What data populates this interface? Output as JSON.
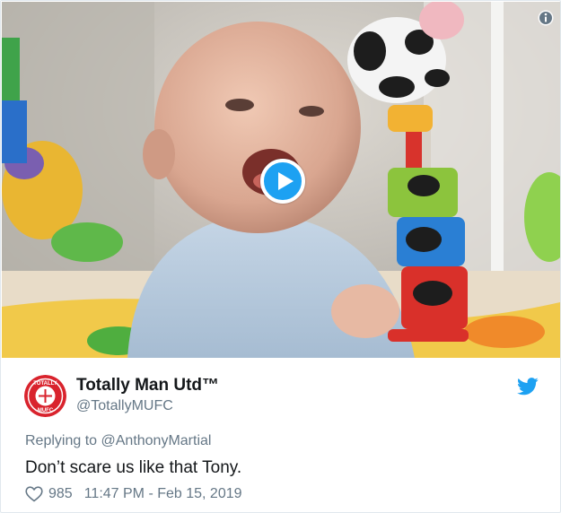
{
  "media": {
    "image": "baby-laughing-gif-thumbnail",
    "play_icon": "play-icon",
    "info_icon": "info-icon"
  },
  "author": {
    "display_name": "Totally Man Utd™",
    "handle": "@TotallyMUFC",
    "avatar": "totally-mufc-badge-avatar",
    "avatar_text_top": "TOTALLY",
    "avatar_text_bottom": "MUFC"
  },
  "reply": {
    "prefix": "Replying to ",
    "mention": "@AnthonyMartial"
  },
  "tweet": {
    "text": "Don’t scare us like that Tony."
  },
  "footer": {
    "like_count": "985",
    "timestamp": "11:47 PM - Feb 15, 2019"
  },
  "colors": {
    "twitter_blue": "#1da1f2",
    "secondary_text": "#657786",
    "primary_text": "#14171a",
    "avatar_red": "#d9232d"
  }
}
